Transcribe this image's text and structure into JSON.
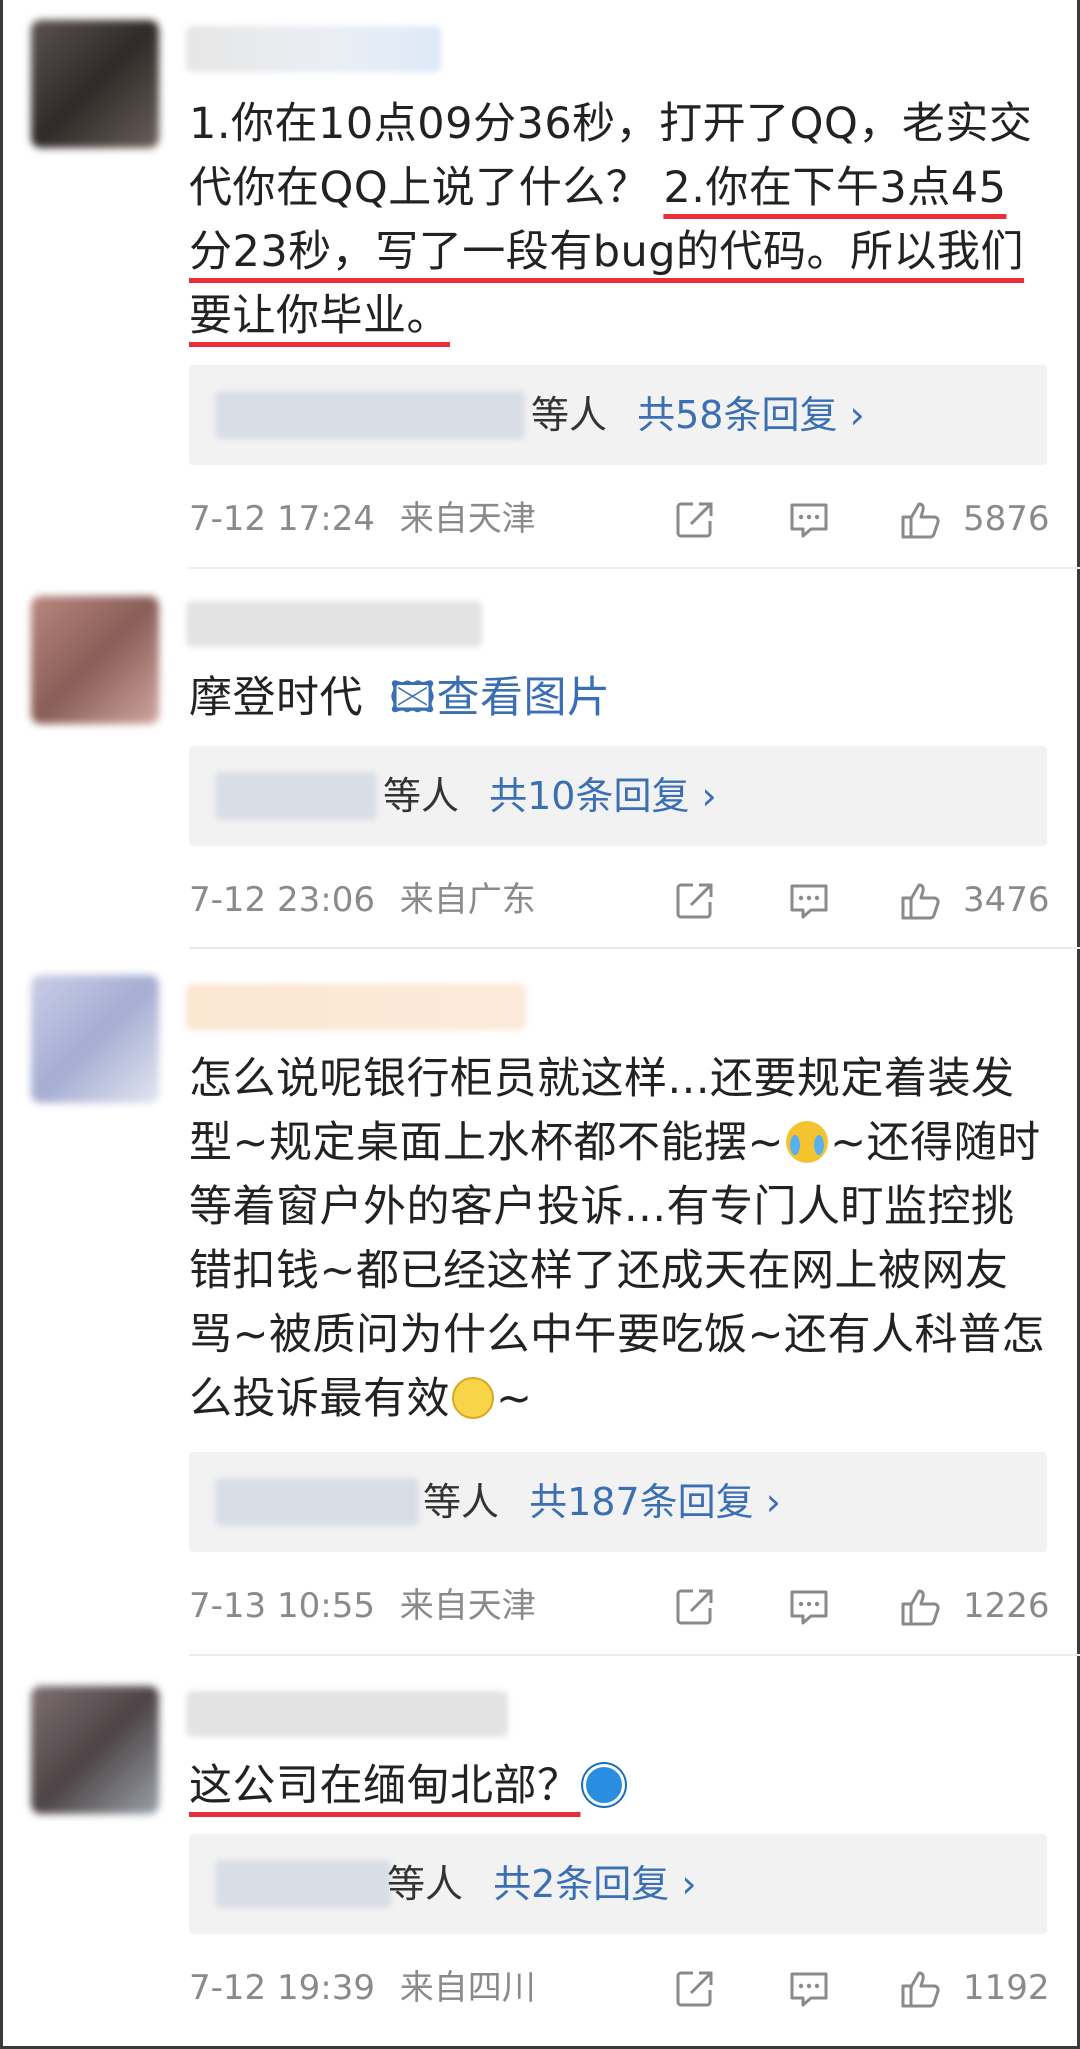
{
  "comments": [
    {
      "text_parts": [
        "1.你在10点09分36秒，打开了QQ，老实交代你在QQ上说了什么？",
        "2.你在下午3点45分23秒，写了一段有bug的代码。所以我们要让你毕业。"
      ],
      "reply_suffix": "等人",
      "reply_link": "共58条回复 ›",
      "time": "7-12 17:24",
      "location": "来自天津",
      "likes": "5876"
    },
    {
      "text": "摩登时代",
      "view_image": "🖾查看图片",
      "reply_suffix": "等人",
      "reply_link": "共10条回复 ›",
      "time": "7-12 23:06",
      "location": "来自广东",
      "likes": "3476"
    },
    {
      "text_parts": [
        "怎么说呢银行柜员就这样...还要规定着装发型~规定桌面上水杯都不能摆~",
        "~还得随时等着窗户外的客户投诉...有专门人盯监控挑错扣钱~都已经这样了还成天在网上被网友骂~被质问为什么中午要吃饭~还有人科普怎么投诉最有效",
        "~"
      ],
      "reply_suffix": "等人",
      "reply_link": "共187条回复 ›",
      "time": "7-13 10:55",
      "location": "来自天津",
      "likes": "1226"
    },
    {
      "text": "这公司在缅甸北部？",
      "reply_suffix": "等人",
      "reply_link": "共2条回复 ›",
      "time": "7-12 19:39",
      "location": "来自四川",
      "likes": "1192"
    }
  ],
  "colors": {
    "underline": "#e8303a",
    "link": "#3a6fb3",
    "meta": "#8a8a8a",
    "reply_bg": "#f2f2f2"
  },
  "icons": [
    "share-icon",
    "comment-icon",
    "like-icon",
    "chevron-right-icon",
    "image-icon"
  ]
}
